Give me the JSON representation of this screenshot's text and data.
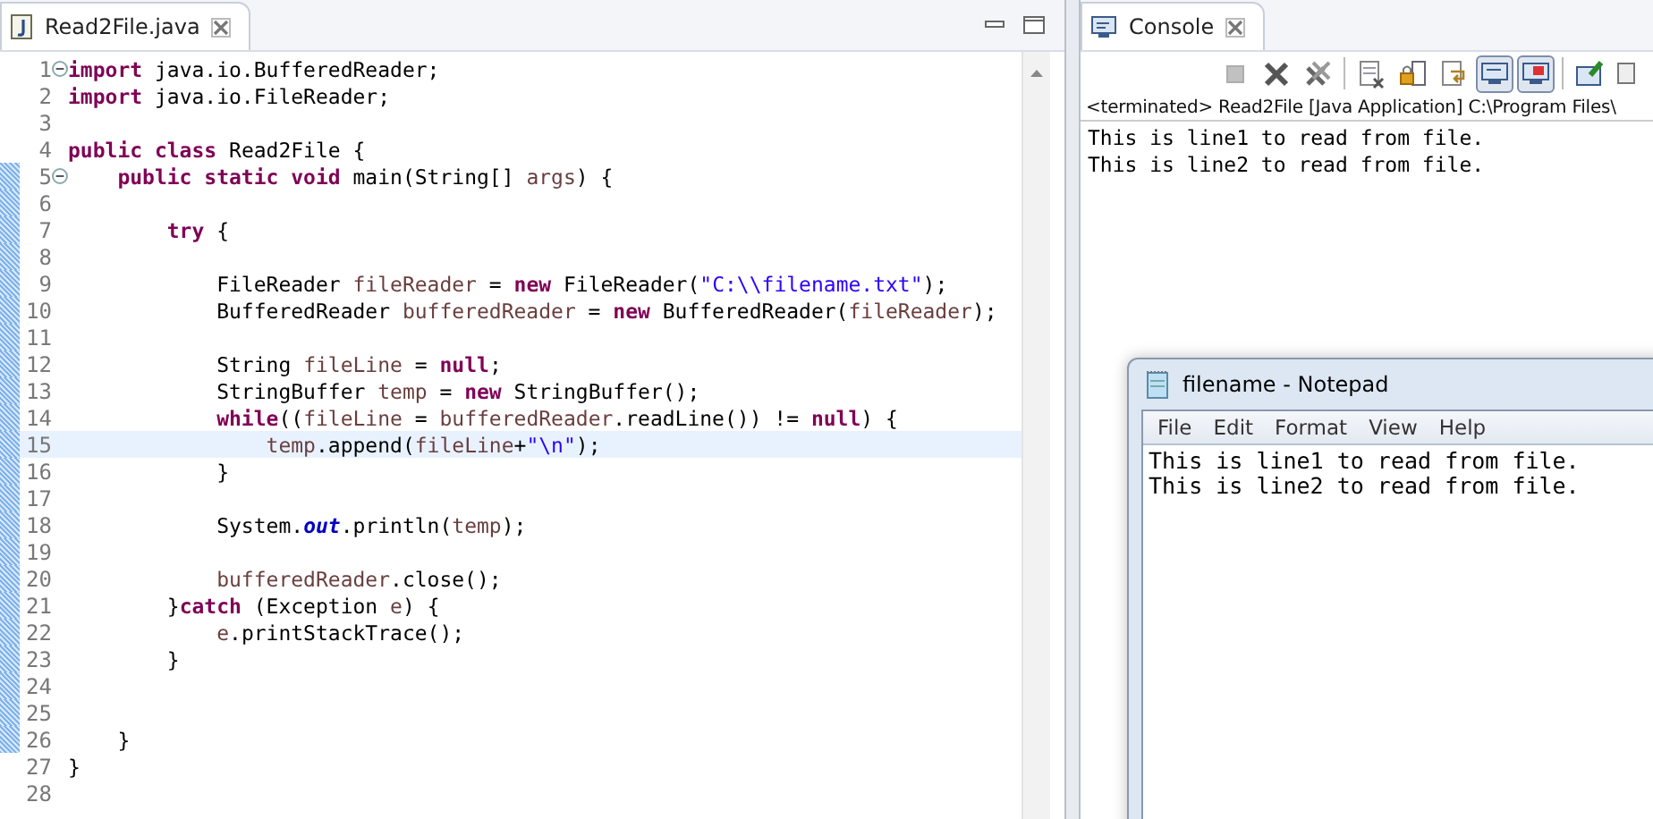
{
  "editor": {
    "tab": {
      "title": "Read2File.java",
      "selected": true
    },
    "lines": [
      {
        "number": "1",
        "foldable": true,
        "in_range": false,
        "current": false,
        "tokens": [
          {
            "kind": "kw",
            "text": "import"
          },
          {
            "kind": "plain",
            "text": " java.io.BufferedReader;"
          }
        ]
      },
      {
        "number": "2",
        "foldable": false,
        "in_range": false,
        "current": false,
        "tokens": [
          {
            "kind": "kw",
            "text": "import"
          },
          {
            "kind": "plain",
            "text": " java.io.FileReader;"
          }
        ]
      },
      {
        "number": "3",
        "foldable": false,
        "in_range": false,
        "current": false
      },
      {
        "number": "4",
        "foldable": false,
        "in_range": false,
        "current": false,
        "tokens": [
          {
            "kind": "kw",
            "text": "public class"
          },
          {
            "kind": "plain",
            "text": " Read2File {"
          }
        ]
      },
      {
        "number": "5",
        "foldable": true,
        "in_range": true,
        "current": false,
        "tokens": [
          {
            "kind": "kw",
            "text": "    public static void"
          },
          {
            "kind": "plain",
            "text": " main(String[] "
          },
          {
            "kind": "var",
            "text": "args"
          },
          {
            "kind": "plain",
            "text": ") {"
          }
        ]
      },
      {
        "number": "6",
        "foldable": false,
        "in_range": true,
        "current": false
      },
      {
        "number": "7",
        "foldable": false,
        "in_range": true,
        "current": false,
        "tokens": [
          {
            "kind": "kw",
            "text": "        try"
          },
          {
            "kind": "plain",
            "text": " {"
          }
        ]
      },
      {
        "number": "8",
        "foldable": false,
        "in_range": true,
        "current": false
      },
      {
        "number": "9",
        "foldable": false,
        "in_range": true,
        "current": false,
        "tokens": [
          {
            "kind": "plain",
            "text": "            FileReader "
          },
          {
            "kind": "var",
            "text": "fileReader"
          },
          {
            "kind": "plain",
            "text": " = "
          },
          {
            "kind": "kw",
            "text": "new"
          },
          {
            "kind": "plain",
            "text": " FileReader("
          },
          {
            "kind": "str",
            "text": "\"C:\\\\filename.txt\""
          },
          {
            "kind": "plain",
            "text": ");"
          }
        ]
      },
      {
        "number": "10",
        "foldable": false,
        "in_range": true,
        "current": false,
        "tokens": [
          {
            "kind": "plain",
            "text": "            BufferedReader "
          },
          {
            "kind": "var",
            "text": "bufferedReader"
          },
          {
            "kind": "plain",
            "text": " = "
          },
          {
            "kind": "kw",
            "text": "new"
          },
          {
            "kind": "plain",
            "text": " BufferedReader("
          },
          {
            "kind": "var",
            "text": "fileReader"
          },
          {
            "kind": "plain",
            "text": ");"
          }
        ]
      },
      {
        "number": "11",
        "foldable": false,
        "in_range": true,
        "current": false
      },
      {
        "number": "12",
        "foldable": false,
        "in_range": true,
        "current": false,
        "tokens": [
          {
            "kind": "plain",
            "text": "            String "
          },
          {
            "kind": "var",
            "text": "fileLine"
          },
          {
            "kind": "plain",
            "text": " = "
          },
          {
            "kind": "kw",
            "text": "null"
          },
          {
            "kind": "plain",
            "text": ";"
          }
        ]
      },
      {
        "number": "13",
        "foldable": false,
        "in_range": true,
        "current": false,
        "tokens": [
          {
            "kind": "plain",
            "text": "            StringBuffer "
          },
          {
            "kind": "var",
            "text": "temp"
          },
          {
            "kind": "plain",
            "text": " = "
          },
          {
            "kind": "kw",
            "text": "new"
          },
          {
            "kind": "plain",
            "text": " StringBuffer();"
          }
        ]
      },
      {
        "number": "14",
        "foldable": false,
        "in_range": true,
        "current": false,
        "tokens": [
          {
            "kind": "kw",
            "text": "            while"
          },
          {
            "kind": "plain",
            "text": "(("
          },
          {
            "kind": "var",
            "text": "fileLine"
          },
          {
            "kind": "plain",
            "text": " = "
          },
          {
            "kind": "var",
            "text": "bufferedReader"
          },
          {
            "kind": "plain",
            "text": ".readLine()) != "
          },
          {
            "kind": "kw",
            "text": "null"
          },
          {
            "kind": "plain",
            "text": ") {"
          }
        ]
      },
      {
        "number": "15",
        "foldable": false,
        "in_range": true,
        "current": true,
        "tokens": [
          {
            "kind": "var",
            "text": "                temp"
          },
          {
            "kind": "plain",
            "text": ".append("
          },
          {
            "kind": "var",
            "text": "fileLine"
          },
          {
            "kind": "plain",
            "text": "+"
          },
          {
            "kind": "str",
            "text": "\"\\n\""
          },
          {
            "kind": "plain",
            "text": ");"
          }
        ]
      },
      {
        "number": "16",
        "foldable": false,
        "in_range": true,
        "current": false,
        "tokens": [
          {
            "kind": "plain",
            "text": "            }"
          }
        ]
      },
      {
        "number": "17",
        "foldable": false,
        "in_range": true,
        "current": false
      },
      {
        "number": "18",
        "foldable": false,
        "in_range": true,
        "current": false,
        "tokens": [
          {
            "kind": "plain",
            "text": "            System."
          },
          {
            "kind": "static",
            "text": "out"
          },
          {
            "kind": "plain",
            "text": ".println("
          },
          {
            "kind": "var",
            "text": "temp"
          },
          {
            "kind": "plain",
            "text": ");"
          }
        ]
      },
      {
        "number": "19",
        "foldable": false,
        "in_range": true,
        "current": false
      },
      {
        "number": "20",
        "foldable": false,
        "in_range": true,
        "current": false,
        "tokens": [
          {
            "kind": "var",
            "text": "            bufferedReader"
          },
          {
            "kind": "plain",
            "text": ".close();"
          }
        ]
      },
      {
        "number": "21",
        "foldable": false,
        "in_range": true,
        "current": false,
        "tokens": [
          {
            "kind": "plain",
            "text": "        }"
          },
          {
            "kind": "kw",
            "text": "catch"
          },
          {
            "kind": "plain",
            "text": " (Exception "
          },
          {
            "kind": "var",
            "text": "e"
          },
          {
            "kind": "plain",
            "text": ") {"
          }
        ]
      },
      {
        "number": "22",
        "foldable": false,
        "in_range": true,
        "current": false,
        "tokens": [
          {
            "kind": "var",
            "text": "            e"
          },
          {
            "kind": "plain",
            "text": ".printStackTrace();"
          }
        ]
      },
      {
        "number": "23",
        "foldable": false,
        "in_range": true,
        "current": false,
        "tokens": [
          {
            "kind": "plain",
            "text": "        }"
          }
        ]
      },
      {
        "number": "24",
        "foldable": false,
        "in_range": true,
        "current": false
      },
      {
        "number": "25",
        "foldable": false,
        "in_range": true,
        "current": false
      },
      {
        "number": "26",
        "foldable": false,
        "in_range": true,
        "current": false,
        "tokens": [
          {
            "kind": "plain",
            "text": "    }"
          }
        ]
      },
      {
        "number": "27",
        "foldable": false,
        "in_range": false,
        "current": false,
        "tokens": [
          {
            "kind": "plain",
            "text": "}"
          }
        ]
      },
      {
        "number": "28",
        "foldable": false,
        "in_range": false,
        "current": false
      }
    ]
  },
  "console": {
    "tab": {
      "title": "Console",
      "selected": true
    },
    "toolbar_groups": [
      [
        {
          "kind": "stop",
          "disabled": true,
          "pressed": false
        },
        {
          "kind": "remove",
          "disabled": false,
          "pressed": false
        },
        {
          "kind": "remove-all",
          "disabled": false,
          "pressed": false
        }
      ],
      [
        {
          "kind": "clear",
          "disabled": false,
          "pressed": false
        },
        {
          "kind": "lock",
          "disabled": false,
          "pressed": false
        },
        {
          "kind": "wrap",
          "disabled": false,
          "pressed": false
        },
        {
          "kind": "show-out",
          "disabled": false,
          "pressed": true
        },
        {
          "kind": "show-err",
          "disabled": false,
          "pressed": true
        }
      ],
      [
        {
          "kind": "pin",
          "disabled": false,
          "pressed": false
        },
        {
          "kind": "display",
          "disabled": false,
          "pressed": false
        }
      ]
    ],
    "status": "<terminated> Read2File [Java Application] C:\\Program Files\\",
    "output": [
      "This is line1 to read from file.",
      "This is line2 to read from file."
    ]
  },
  "notepad": {
    "title": "filename - Notepad",
    "menu": [
      "File",
      "Edit",
      "Format",
      "View",
      "Help"
    ],
    "text": [
      "This is line1 to read from file.",
      "This is line2 to read from file."
    ]
  }
}
